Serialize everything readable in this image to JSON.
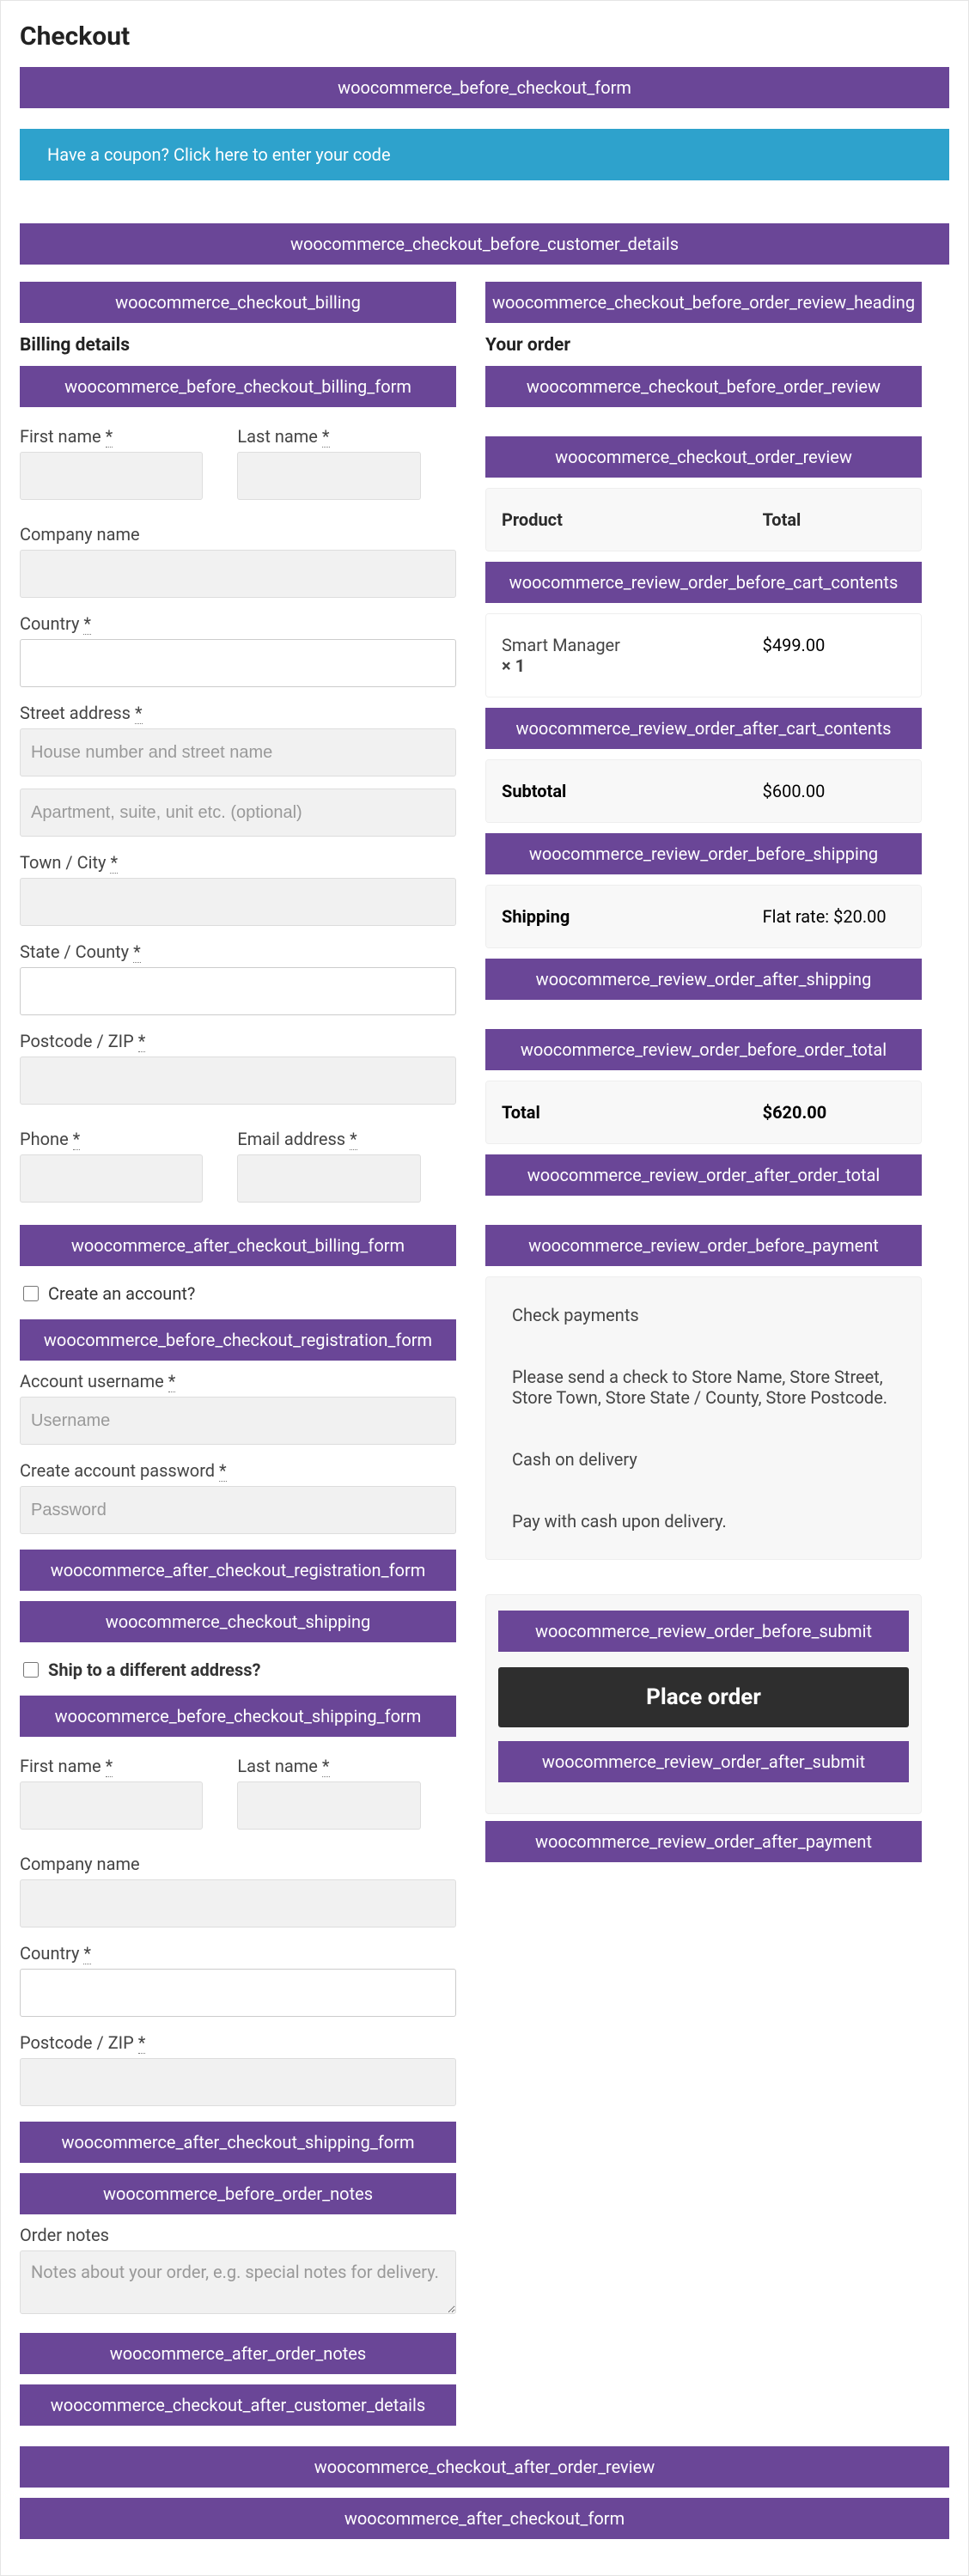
{
  "page_title": "Checkout",
  "hooks": {
    "before_checkout_form": "woocommerce_before_checkout_form",
    "before_customer_details": "woocommerce_checkout_before_customer_details",
    "checkout_billing": "woocommerce_checkout_billing",
    "before_checkout_billing_form": "woocommerce_before_checkout_billing_form",
    "after_checkout_billing_form": "woocommerce_after_checkout_billing_form",
    "before_checkout_registration_form": "woocommerce_before_checkout_registration_form",
    "after_checkout_registration_form": "woocommerce_after_checkout_registration_form",
    "checkout_shipping": "woocommerce_checkout_shipping",
    "before_checkout_shipping_form": "woocommerce_before_checkout_shipping_form",
    "after_checkout_shipping_form": "woocommerce_after_checkout_shipping_form",
    "before_order_notes": "woocommerce_before_order_notes",
    "after_order_notes": "woocommerce_after_order_notes",
    "after_customer_details": "woocommerce_checkout_after_customer_details",
    "before_order_review_heading": "woocommerce_checkout_before_order_review_heading",
    "before_order_review": "woocommerce_checkout_before_order_review",
    "order_review": "woocommerce_checkout_order_review",
    "review_before_cart_contents": "woocommerce_review_order_before_cart_contents",
    "review_after_cart_contents": "woocommerce_review_order_after_cart_contents",
    "review_before_shipping": "woocommerce_review_order_before_shipping",
    "review_after_shipping": "woocommerce_review_order_after_shipping",
    "review_before_order_total": "woocommerce_review_order_before_order_total",
    "review_after_order_total": "woocommerce_review_order_after_order_total",
    "review_before_payment": "woocommerce_review_order_before_payment",
    "review_before_submit": "woocommerce_review_order_before_submit",
    "review_after_submit": "woocommerce_review_order_after_submit",
    "review_after_payment": "woocommerce_review_order_after_payment",
    "checkout_after_order_review": "woocommerce_checkout_after_order_review",
    "after_checkout_form": "woocommerce_after_checkout_form"
  },
  "coupon_text": "Have a coupon? Click here to enter your code",
  "billing": {
    "heading": "Billing details",
    "first_name": "First name ",
    "last_name": "Last name ",
    "company": "Company name",
    "country": "Country ",
    "street": "Street address ",
    "street_ph1": "House number and street name",
    "street_ph2": "Apartment, suite, unit etc. (optional)",
    "city": "Town / City ",
    "state": "State / County ",
    "postcode": "Postcode / ZIP ",
    "phone": "Phone ",
    "email": "Email address ",
    "req": "*"
  },
  "account": {
    "create_checkbox": "Create an account?",
    "username_label": "Account username ",
    "username_ph": "Username",
    "password_label": "Create account password ",
    "password_ph": "Password"
  },
  "shipping": {
    "checkbox": "Ship to a different address?",
    "first_name": "First name ",
    "last_name": "Last name ",
    "company": "Company name",
    "country": "Country ",
    "postcode": "Postcode / ZIP "
  },
  "notes": {
    "label": "Order notes",
    "placeholder": "Notes about your order, e.g. special notes for delivery."
  },
  "order": {
    "heading": "Your order",
    "th_product": "Product",
    "th_total": "Total",
    "item_name": "Smart Manager",
    "item_qty": "× 1",
    "item_total": "$499.00",
    "subtotal_label": "Subtotal",
    "subtotal_value": "$600.00",
    "shipping_label": "Shipping",
    "shipping_value": "Flat rate: $20.00",
    "total_label": "Total",
    "total_value": "$620.00"
  },
  "payment": {
    "check_title": "Check payments",
    "check_desc": "Please send a check to Store Name, Store Street, Store Town, Store State / County, Store Postcode.",
    "cod_title": "Cash on delivery",
    "cod_desc": "Pay with cash upon delivery."
  },
  "place_order": "Place order"
}
